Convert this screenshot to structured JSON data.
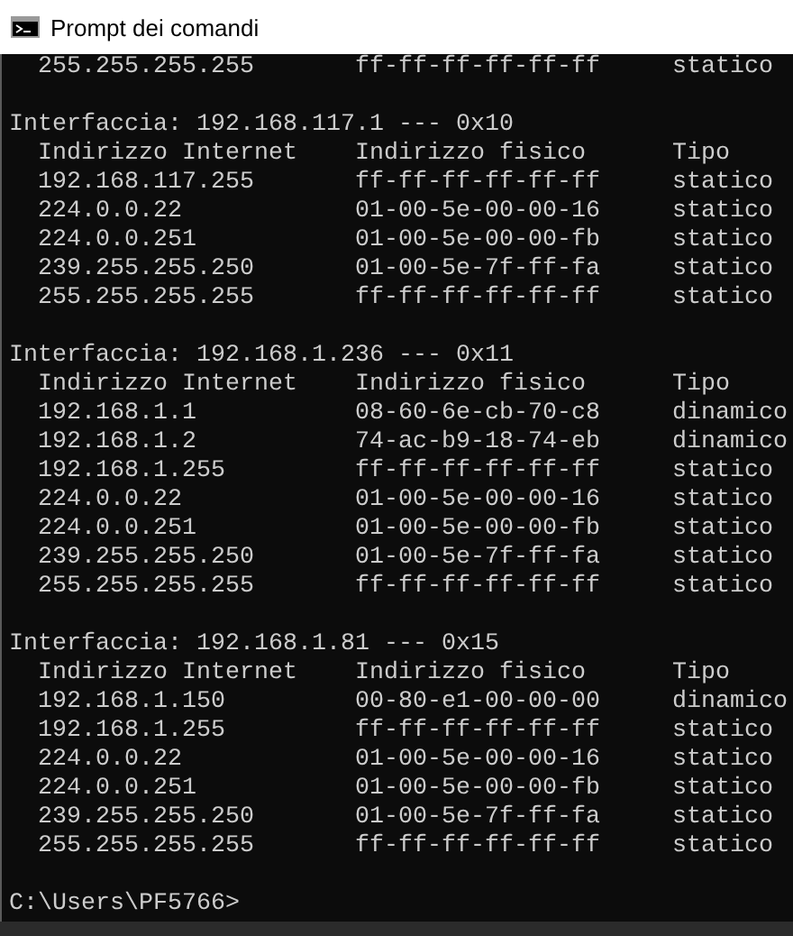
{
  "window": {
    "title": "Prompt dei comandi"
  },
  "leading_entry": {
    "internet_address": "255.255.255.255",
    "physical_address": "ff-ff-ff-ff-ff-ff",
    "type": "statico"
  },
  "interfaces": [
    {
      "header": "Interfaccia: 192.168.117.1 --- 0x10",
      "columns": [
        "Indirizzo Internet",
        "Indirizzo fisico",
        "Tipo"
      ],
      "entries": [
        {
          "internet_address": "192.168.117.255",
          "physical_address": "ff-ff-ff-ff-ff-ff",
          "type": "statico"
        },
        {
          "internet_address": "224.0.0.22",
          "physical_address": "01-00-5e-00-00-16",
          "type": "statico"
        },
        {
          "internet_address": "224.0.0.251",
          "physical_address": "01-00-5e-00-00-fb",
          "type": "statico"
        },
        {
          "internet_address": "239.255.255.250",
          "physical_address": "01-00-5e-7f-ff-fa",
          "type": "statico"
        },
        {
          "internet_address": "255.255.255.255",
          "physical_address": "ff-ff-ff-ff-ff-ff",
          "type": "statico"
        }
      ]
    },
    {
      "header": "Interfaccia: 192.168.1.236 --- 0x11",
      "columns": [
        "Indirizzo Internet",
        "Indirizzo fisico",
        "Tipo"
      ],
      "entries": [
        {
          "internet_address": "192.168.1.1",
          "physical_address": "08-60-6e-cb-70-c8",
          "type": "dinamico"
        },
        {
          "internet_address": "192.168.1.2",
          "physical_address": "74-ac-b9-18-74-eb",
          "type": "dinamico"
        },
        {
          "internet_address": "192.168.1.255",
          "physical_address": "ff-ff-ff-ff-ff-ff",
          "type": "statico"
        },
        {
          "internet_address": "224.0.0.22",
          "physical_address": "01-00-5e-00-00-16",
          "type": "statico"
        },
        {
          "internet_address": "224.0.0.251",
          "physical_address": "01-00-5e-00-00-fb",
          "type": "statico"
        },
        {
          "internet_address": "239.255.255.250",
          "physical_address": "01-00-5e-7f-ff-fa",
          "type": "statico"
        },
        {
          "internet_address": "255.255.255.255",
          "physical_address": "ff-ff-ff-ff-ff-ff",
          "type": "statico"
        }
      ]
    },
    {
      "header": "Interfaccia: 192.168.1.81 --- 0x15",
      "columns": [
        "Indirizzo Internet",
        "Indirizzo fisico",
        "Tipo"
      ],
      "entries": [
        {
          "internet_address": "192.168.1.150",
          "physical_address": "00-80-e1-00-00-00",
          "type": "dinamico"
        },
        {
          "internet_address": "192.168.1.255",
          "physical_address": "ff-ff-ff-ff-ff-ff",
          "type": "statico"
        },
        {
          "internet_address": "224.0.0.22",
          "physical_address": "01-00-5e-00-00-16",
          "type": "statico"
        },
        {
          "internet_address": "224.0.0.251",
          "physical_address": "01-00-5e-00-00-fb",
          "type": "statico"
        },
        {
          "internet_address": "239.255.255.250",
          "physical_address": "01-00-5e-7f-ff-fa",
          "type": "statico"
        },
        {
          "internet_address": "255.255.255.255",
          "physical_address": "ff-ff-ff-ff-ff-ff",
          "type": "statico"
        }
      ]
    }
  ],
  "prompt": "C:\\Users\\PF5766>"
}
